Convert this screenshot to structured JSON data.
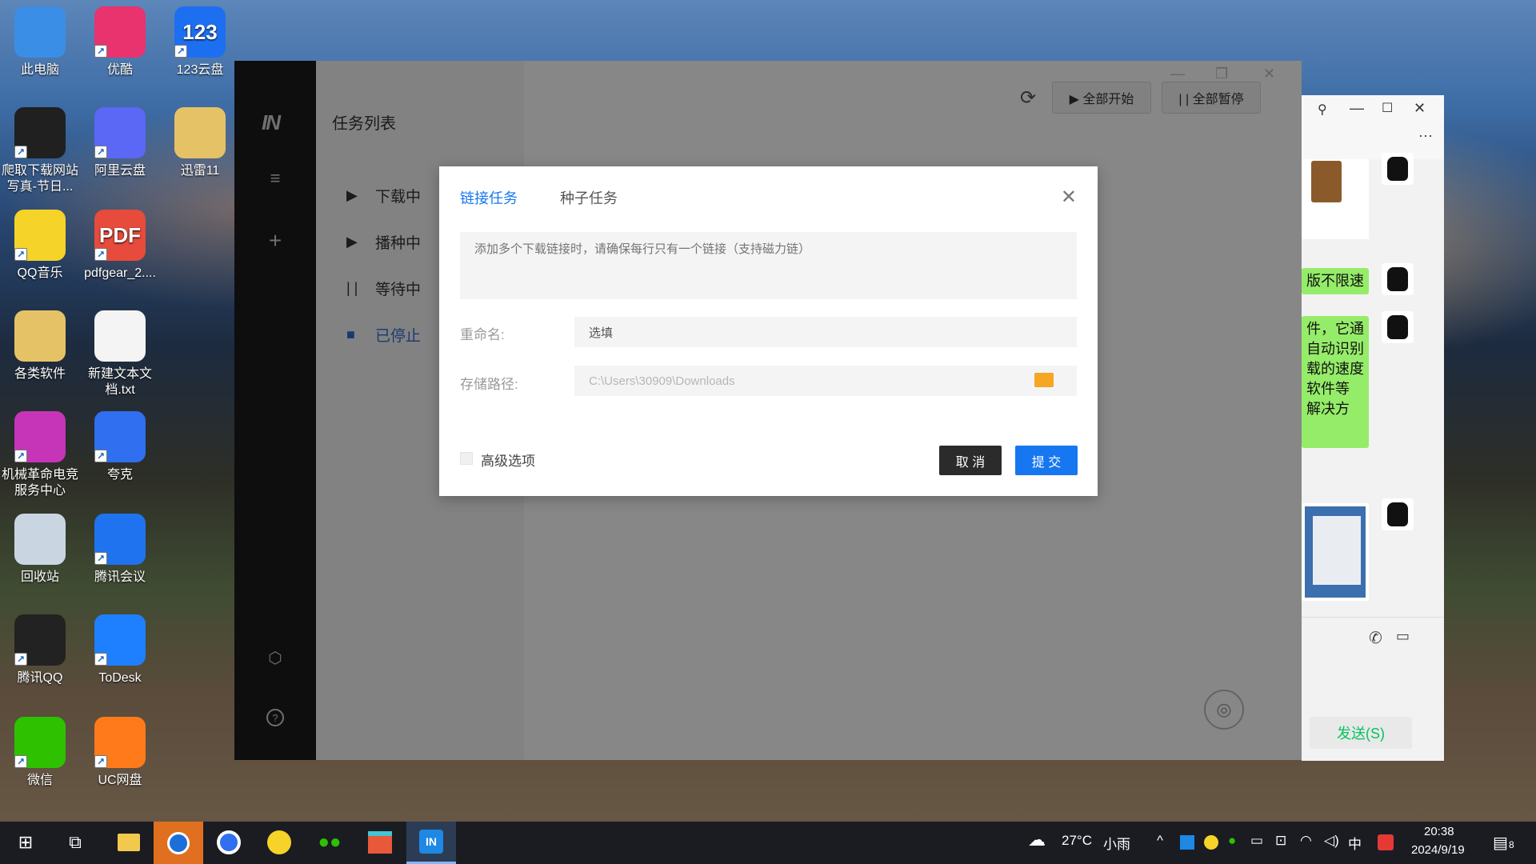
{
  "desktop": {
    "icons": [
      {
        "label": "此电脑",
        "icon": "this-pc-icon",
        "color": "#3a8ee6"
      },
      {
        "label": "优酷",
        "icon": "youku-icon",
        "color": "#e8336f"
      },
      {
        "label": "123云盘",
        "icon": "123pan-icon",
        "color": "#1d6ff2",
        "glyph": "123"
      },
      {
        "label": "爬取下载网站写真-节日...",
        "icon": "folder-image-icon",
        "color": "#202020"
      },
      {
        "label": "阿里云盘",
        "icon": "aliyun-drive-icon",
        "color": "#5b67f5"
      },
      {
        "label": "迅雷11",
        "icon": "folder-icon",
        "color": "#e6c267"
      },
      {
        "label": "QQ音乐",
        "icon": "qq-music-icon",
        "color": "#f5d328"
      },
      {
        "label": "pdfgear_2....",
        "icon": "pdf-file-icon",
        "color": "#e64b3c",
        "glyph": "PDF"
      },
      {
        "label": "各类软件",
        "icon": "folder-icon",
        "color": "#e6c267"
      },
      {
        "label": "新建文本文档.txt",
        "icon": "text-file-icon",
        "color": "#f4f4f4"
      },
      {
        "label": "机械革命电竞服务中心",
        "icon": "mechrevo-icon",
        "color": "#c635b8"
      },
      {
        "label": "夸克",
        "icon": "quark-icon",
        "color": "#2f6ff0"
      },
      {
        "label": "回收站",
        "icon": "recycle-bin-icon",
        "color": "#c9d6e2"
      },
      {
        "label": "腾讯会议",
        "icon": "tencent-meeting-icon",
        "color": "#1f73ef"
      },
      {
        "label": "腾讯QQ",
        "icon": "qq-icon",
        "color": "#222222"
      },
      {
        "label": "ToDesk",
        "icon": "todesk-icon",
        "color": "#1e80ff"
      },
      {
        "label": "微信",
        "icon": "wechat-icon",
        "color": "#2dc100"
      },
      {
        "label": "UC网盘",
        "icon": "uc-drive-icon",
        "color": "#ff7a1a"
      }
    ]
  },
  "app": {
    "logo": "IN",
    "title": "任务列表",
    "nav": [
      {
        "label": "下载中",
        "glyph": "▶"
      },
      {
        "label": "播种中",
        "glyph": "▶"
      },
      {
        "label": "等待中",
        "glyph": "| |"
      },
      {
        "label": "已停止",
        "glyph": "■"
      }
    ],
    "toolbar": {
      "start_all": "▶ 全部开始",
      "pause_all": "| | 全部暂停"
    },
    "colors": {
      "accent": "#2f6fd0",
      "sidebar": "#1b1b1d"
    }
  },
  "dialog": {
    "tab_link": "链接任务",
    "tab_torrent": "种子任务",
    "links_placeholder": "添加多个下载链接时，请确保每行只有一个链接（支持磁力链）",
    "rename_label": "重命名:",
    "rename_value": "选填",
    "path_label": "存储路径:",
    "path_value": "C:\\Users\\30909\\Downloads",
    "advanced_label": "高级选项",
    "cancel": "取 消",
    "submit": "提 交",
    "colors": {
      "submit": "#1677f0",
      "cancel": "#2b2b2b"
    }
  },
  "chat": {
    "bubbles": [
      "版不限速",
      "件，它通\n自动识别\n载的速度\n 软件等\n解决方"
    ],
    "send_label": "发送(S)"
  },
  "taskbar": {
    "weather_temp": "27°C",
    "weather_desc": "小雨",
    "ime": "中",
    "time": "20:38",
    "date": "2024/9/19",
    "notifications": "8"
  }
}
